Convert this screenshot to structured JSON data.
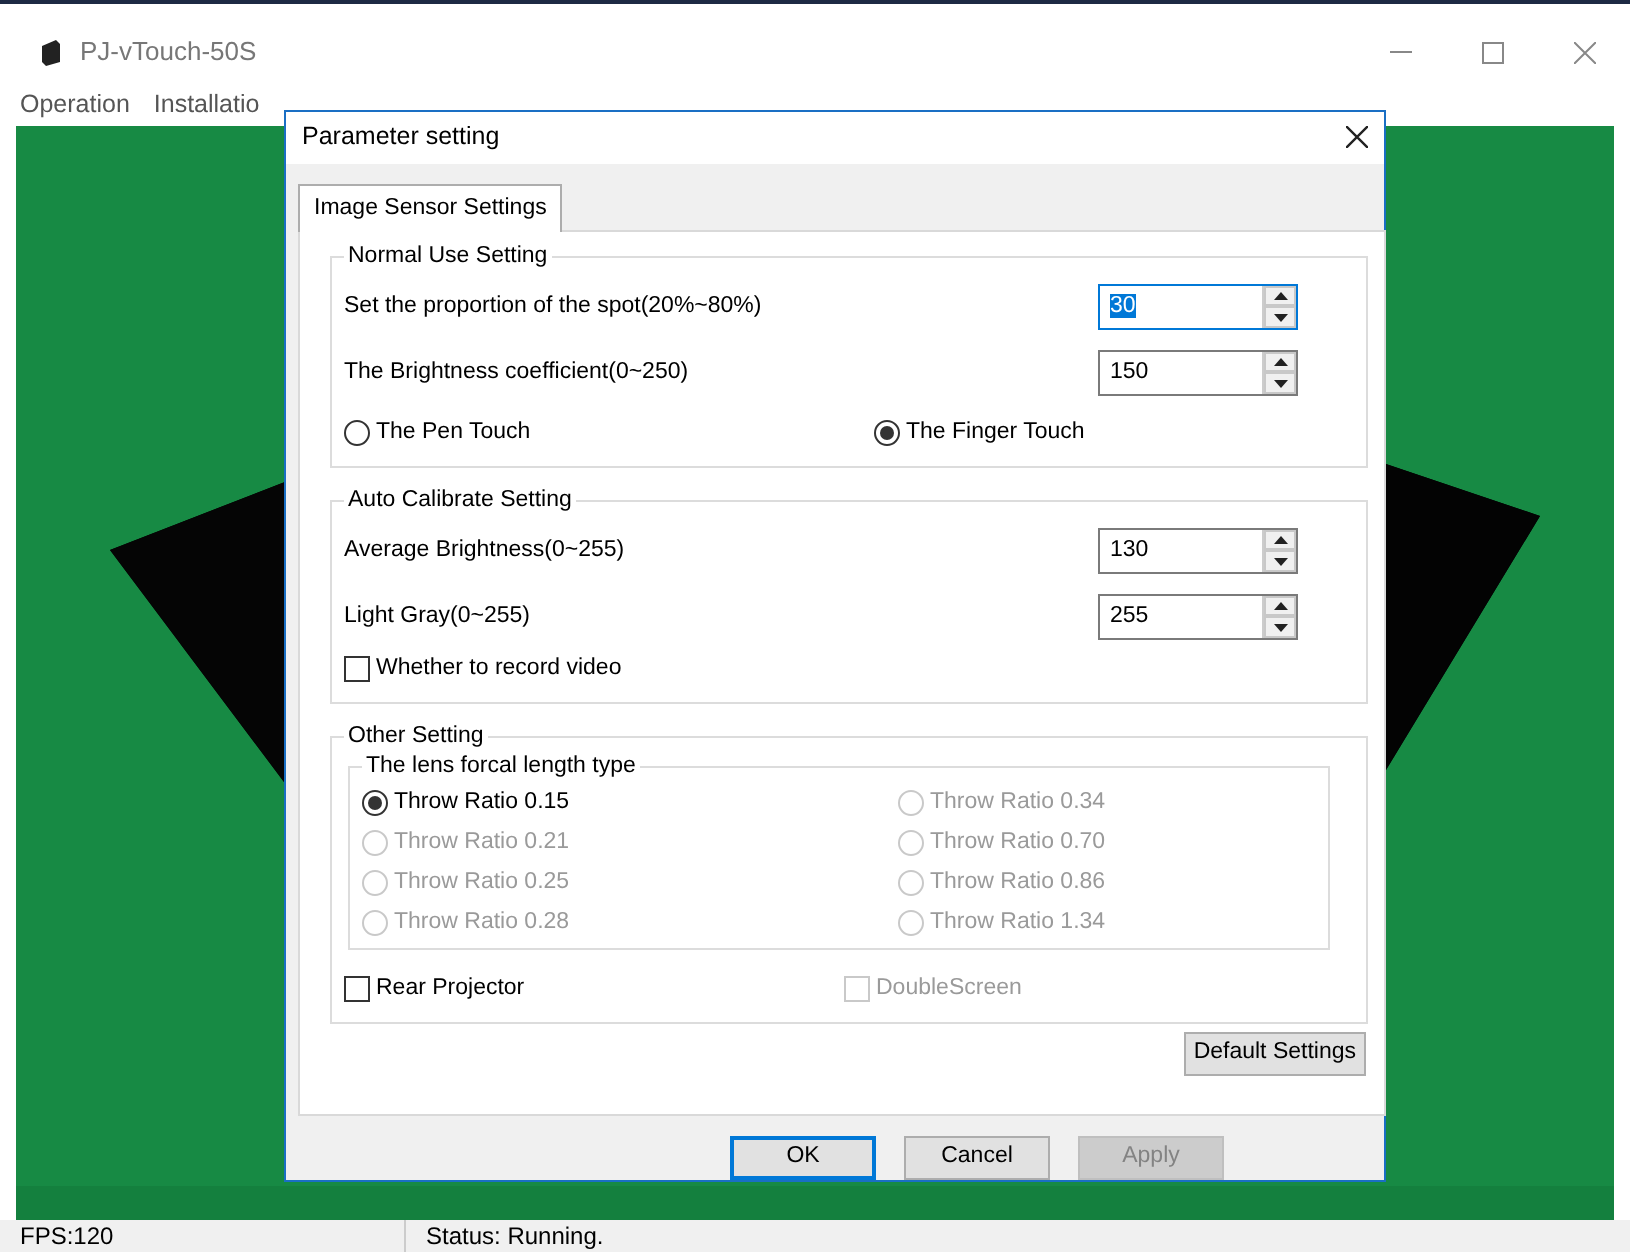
{
  "window": {
    "title": "PJ-vTouch-50S"
  },
  "menu": [
    {
      "label": "Operation"
    },
    {
      "label": "Installatio"
    }
  ],
  "dialog": {
    "title": "Parameter setting",
    "tabs": [
      {
        "label": "Image Sensor Settings",
        "selected": true
      }
    ],
    "normal": {
      "title": "Normal Use Setting",
      "fields": [
        {
          "label": "Set the proportion of the spot(20%~80%)",
          "value": "30",
          "focused": true
        },
        {
          "label": "The Brightness coefficient(0~250)",
          "value": "150",
          "focused": false
        }
      ],
      "modes": [
        {
          "label": "The Pen Touch",
          "selected": false
        },
        {
          "label": "The Finger Touch",
          "selected": true
        }
      ]
    },
    "auto": {
      "title": "Auto Calibrate Setting",
      "fields": [
        {
          "label": "Average Brightness(0~255)",
          "value": "130",
          "focused": false
        },
        {
          "label": "Light Gray(0~255)",
          "value": "255",
          "focused": false
        }
      ],
      "checkbox": {
        "label": "Whether to record video",
        "checked": false,
        "disabled": false
      }
    },
    "other": {
      "title": "Other Setting",
      "lens": {
        "title": "The lens forcal length type",
        "options": [
          {
            "label": "Throw Ratio 0.15",
            "selected": true,
            "disabled": false
          },
          {
            "label": "Throw Ratio 0.21",
            "selected": false,
            "disabled": true
          },
          {
            "label": "Throw Ratio 0.25",
            "selected": false,
            "disabled": true
          },
          {
            "label": "Throw Ratio 0.28",
            "selected": false,
            "disabled": true
          },
          {
            "label": "Throw Ratio 0.34",
            "selected": false,
            "disabled": true
          },
          {
            "label": "Throw Ratio 0.70",
            "selected": false,
            "disabled": true
          },
          {
            "label": "Throw Ratio 0.86",
            "selected": false,
            "disabled": true
          },
          {
            "label": "Throw Ratio 1.34",
            "selected": false,
            "disabled": true
          }
        ]
      },
      "checkboxes": [
        {
          "label": "Rear Projector",
          "checked": false,
          "disabled": false
        },
        {
          "label": "DoubleScreen",
          "checked": false,
          "disabled": true
        }
      ]
    },
    "default_button": {
      "label": "Default Settings"
    },
    "buttons": [
      {
        "label": "OK",
        "default": true,
        "disabled": false
      },
      {
        "label": "Cancel",
        "default": false,
        "disabled": false
      },
      {
        "label": "Apply",
        "default": false,
        "disabled": true
      }
    ]
  },
  "status_bar": [
    {
      "text": "FPS:120"
    },
    {
      "text": "Status: Running."
    }
  ]
}
